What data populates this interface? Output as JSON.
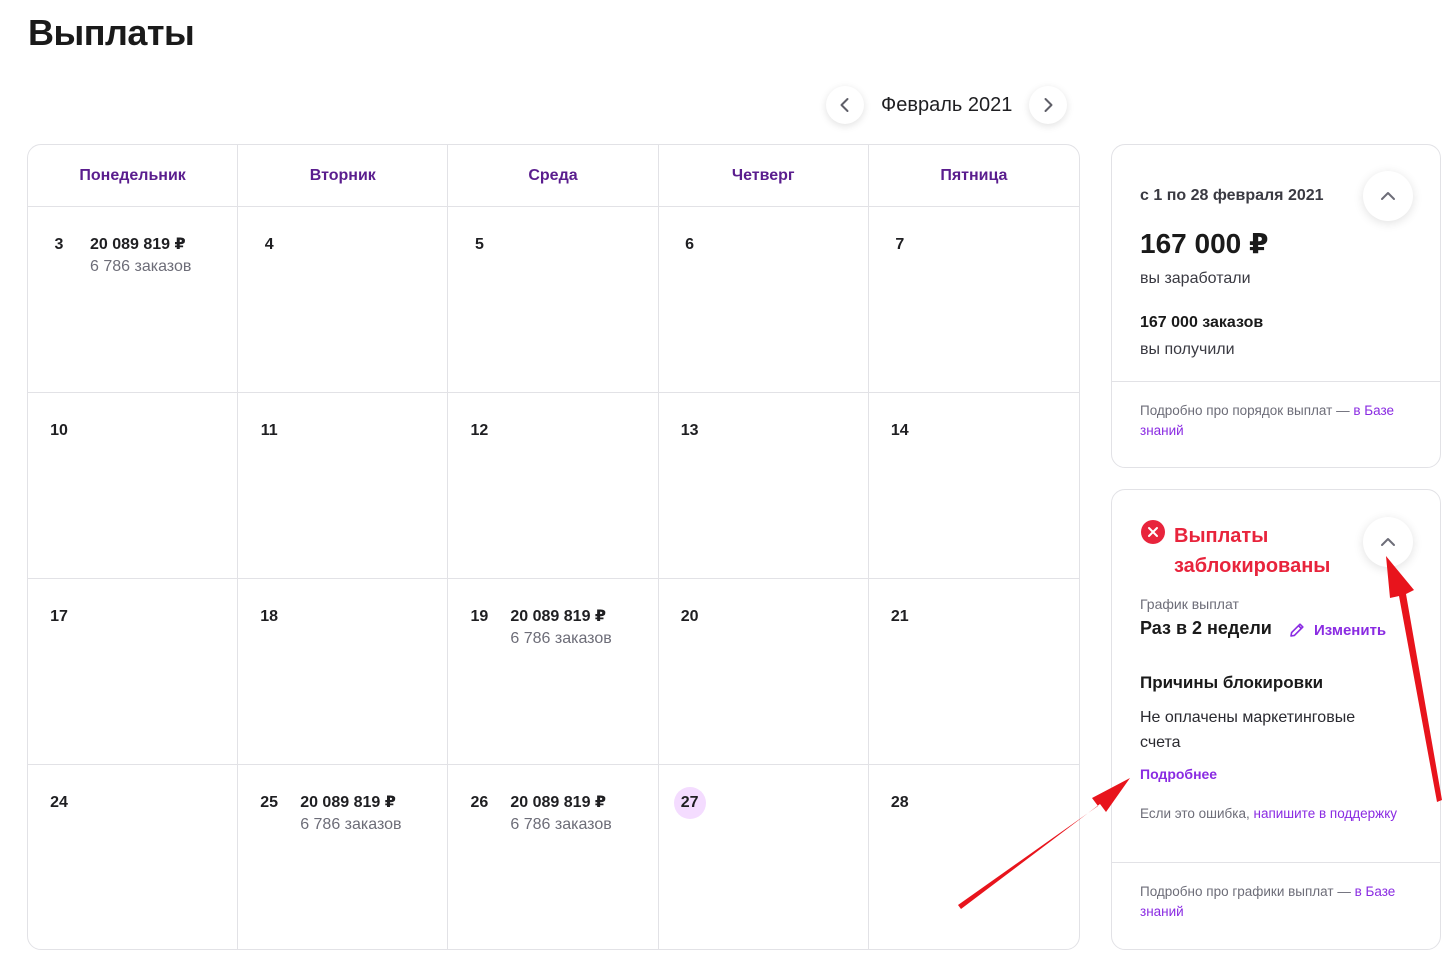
{
  "page": {
    "title": "Выплаты"
  },
  "month_nav": {
    "label": "Февраль 2021",
    "prev_icon": "chevron-left-icon",
    "next_icon": "chevron-right-icon"
  },
  "calendar": {
    "weekdays": [
      "Понедельник",
      "Вторник",
      "Среда",
      "Четверг",
      "Пятница"
    ],
    "cells": [
      {
        "day": "3",
        "amount": "20 089 819 ₽",
        "orders": "6 786 заказов"
      },
      {
        "day": "4"
      },
      {
        "day": "5"
      },
      {
        "day": "6"
      },
      {
        "day": "7"
      },
      {
        "day": "10"
      },
      {
        "day": "11"
      },
      {
        "day": "12"
      },
      {
        "day": "13"
      },
      {
        "day": "14"
      },
      {
        "day": "17"
      },
      {
        "day": "18"
      },
      {
        "day": "19",
        "amount": "20 089 819 ₽",
        "orders": "6 786 заказов"
      },
      {
        "day": "20"
      },
      {
        "day": "21"
      },
      {
        "day": "24"
      },
      {
        "day": "25",
        "amount": "20 089 819 ₽",
        "orders": "6 786 заказов"
      },
      {
        "day": "26",
        "amount": "20 089 819 ₽",
        "orders": "6 786 заказов"
      },
      {
        "day": "27",
        "today": true
      },
      {
        "day": "28"
      }
    ]
  },
  "summary": {
    "period": "с 1 по 28 февраля 2021",
    "total": "167 000 ₽",
    "total_caption": "вы заработали",
    "orders": "167 000 заказов",
    "orders_caption": "вы получили",
    "footer_text": "Подробно про порядок выплат — ",
    "footer_link": "в Базе знаний"
  },
  "blocked": {
    "title": "Выплаты заблокированы",
    "schedule_label": "График выплат",
    "schedule_value": "Раз в 2 недели",
    "edit_label": "Изменить",
    "reasons_title": "Причины блокировки",
    "reason": "Не оплачены маркетинговые счета",
    "more_link": "Подробнее",
    "support_text": "Если это ошибка, ",
    "support_link": "напишите в поддержку",
    "footer_text": "Подробно про графики выплат — ",
    "footer_link": "в Базе знаний"
  },
  "colors": {
    "accent": "#8a2be2",
    "weekday": "#5a1d8e",
    "error": "#e8243c",
    "today_bg": "#f4dcff",
    "annotation_arrow": "#e8141c"
  }
}
